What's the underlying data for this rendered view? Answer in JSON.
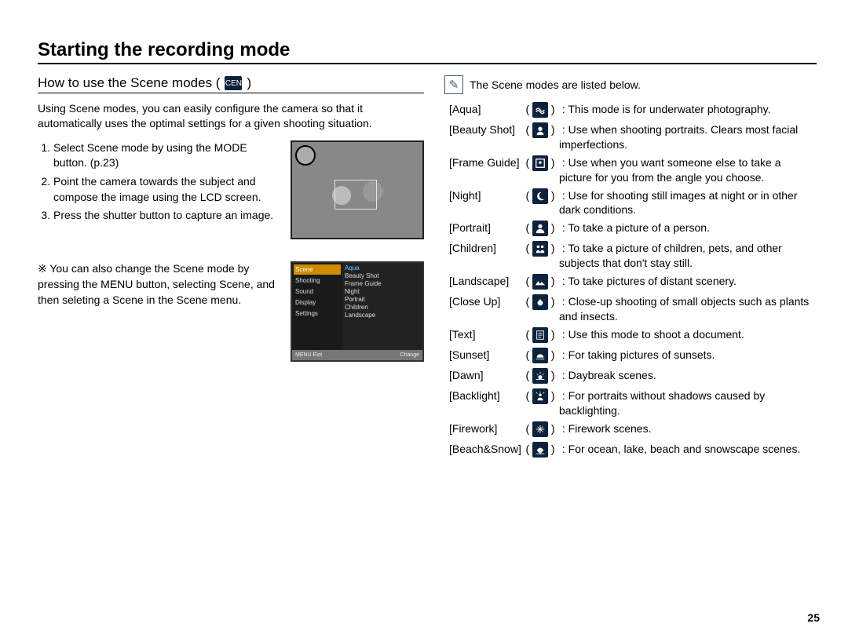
{
  "title": "Starting the recording mode",
  "subTitle": "How to use the Scene modes (",
  "subTitleEnd": ")",
  "subTitleIconName": "SCENE",
  "intro": "Using Scene modes, you can easily configure the camera so that it automatically uses the optimal settings for a given shooting situation.",
  "steps": [
    "Select Scene mode by using the MODE button. (p.23)",
    "Point the camera towards the subject and compose the image using the LCD screen.",
    "Press the shutter button to capture an image."
  ],
  "notePrefix": "※",
  "noteText": "You can also change the Scene mode by pressing the MENU button, selecting Scene, and then seleting a Scene in the Scene menu.",
  "menu": {
    "left": [
      "Scene",
      "Shooting",
      "Sound",
      "Display",
      "Settings"
    ],
    "right": [
      "Aqua",
      "Beauty Shot",
      "Frame Guide",
      "Night",
      "Portrait",
      "Children",
      "Landscape"
    ],
    "bar": {
      "left": "MENU Exit",
      "right": "Change"
    }
  },
  "rightIntro": "The Scene modes are listed below.",
  "scenes": [
    {
      "label": "[Aqua]",
      "icon": "aqua",
      "desc": ": This mode is for underwater photography."
    },
    {
      "label": "[Beauty Shot]",
      "icon": "beauty",
      "desc": ": Use when shooting portraits. Clears most facial imperfections."
    },
    {
      "label": "[Frame Guide]",
      "icon": "frame",
      "desc": ": Use when you want someone else to take a picture for you from the angle you choose."
    },
    {
      "label": "[Night]",
      "icon": "night",
      "desc": ": Use for shooting still images at night or in other dark conditions."
    },
    {
      "label": "[Portrait]",
      "icon": "portrait",
      "desc": ": To take a picture of a person."
    },
    {
      "label": "[Children]",
      "icon": "children",
      "desc": ": To take a picture of children, pets, and other subjects that don't stay still."
    },
    {
      "label": "[Landscape]",
      "icon": "landscape",
      "desc": ": To take pictures of distant scenery."
    },
    {
      "label": "[Close Up]",
      "icon": "closeup",
      "desc": ": Close-up shooting of small objects such as plants and insects."
    },
    {
      "label": "[Text]",
      "icon": "text",
      "desc": ": Use this mode to shoot a document."
    },
    {
      "label": "[Sunset]",
      "icon": "sunset",
      "desc": ": For taking pictures of sunsets."
    },
    {
      "label": "[Dawn]",
      "icon": "dawn",
      "desc": ": Daybreak scenes."
    },
    {
      "label": "[Backlight]",
      "icon": "backlight",
      "desc": ": For portraits without shadows caused by backlighting."
    },
    {
      "label": "[Firework]",
      "icon": "firework",
      "desc": ": Firework scenes."
    },
    {
      "label": "[Beach&Snow]",
      "icon": "beach",
      "desc": ": For ocean, lake, beach and snowscape scenes."
    }
  ],
  "pageNumber": "25"
}
